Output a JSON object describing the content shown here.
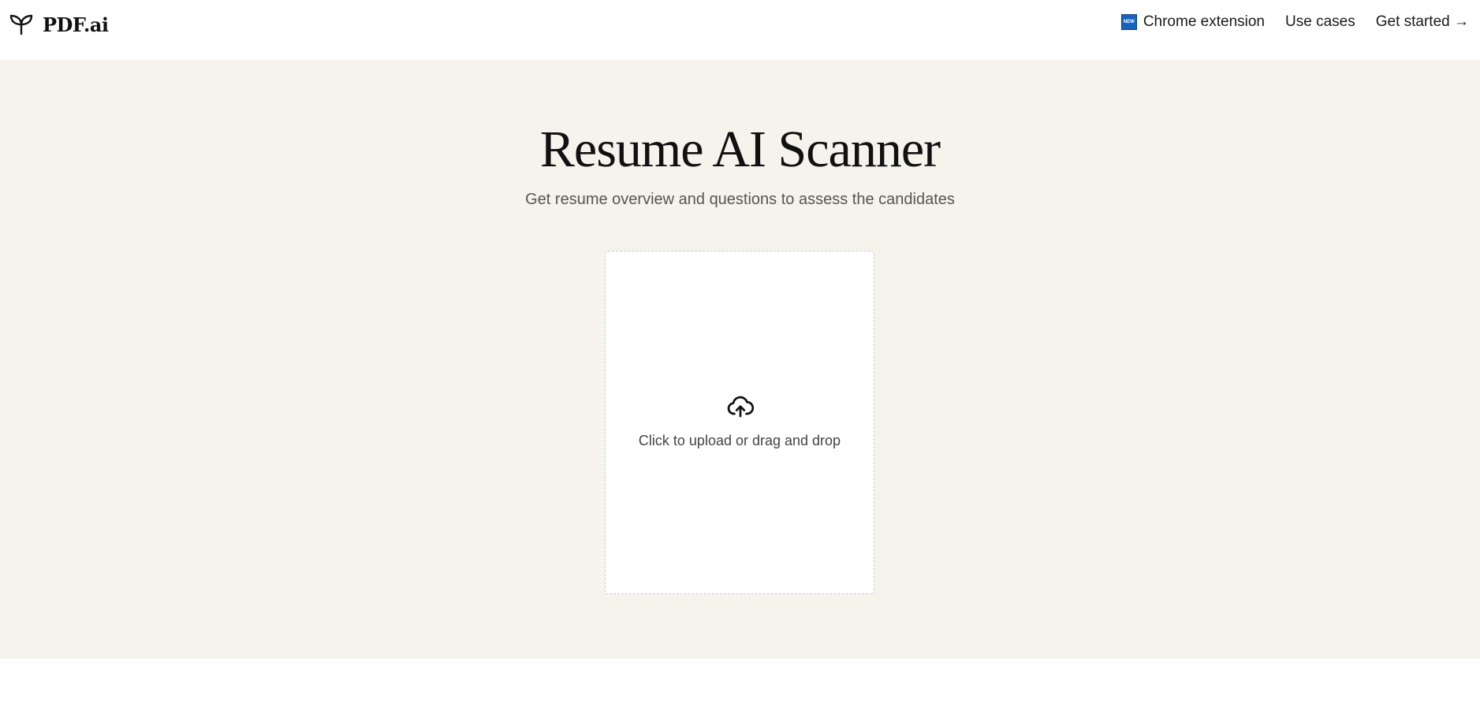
{
  "header": {
    "logo_text": "PDF.ai",
    "logo_icon": "sprout-icon",
    "nav": {
      "chrome_badge": "NEW",
      "chrome_label": "Chrome extension",
      "use_cases_label": "Use cases",
      "get_started_label": "Get started →"
    }
  },
  "hero": {
    "title": "Resume AI Scanner",
    "subtitle": "Get resume overview and questions to assess the candidates",
    "background": "#f6f3ed"
  },
  "upload": {
    "icon": "cloud-upload-icon",
    "label": "Click to upload or drag and drop"
  },
  "colors": {
    "badge_blue": "#1565c0",
    "text_primary": "#111111",
    "text_muted": "#555555"
  }
}
